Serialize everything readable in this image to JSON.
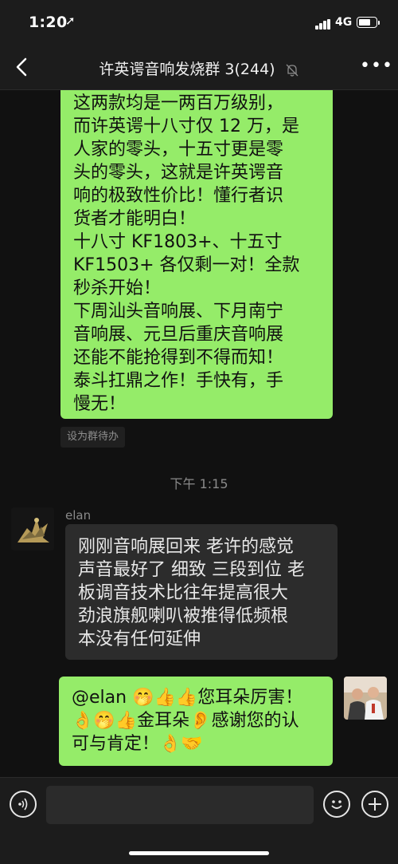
{
  "status": {
    "time": "1:20",
    "network": "4G"
  },
  "nav": {
    "title": "许英谔音响发烧群 3(244)",
    "more": "•••"
  },
  "chat": {
    "msg1_lines": [
      "这两款均是一两百万级别，",
      "而许英谔十八寸仅 12 万，是",
      "人家的零头，十五寸更是零",
      "头的零头，这就是许英谔音",
      "响的极致性价比！懂行者识",
      "货者才能明白！",
      "十八寸 KF1803+、十五寸",
      "KF1503+ 各仅剩一对！全款",
      "秒杀开始！",
      "下周汕头音响展、下月南宁",
      "音响展、元旦后重庆音响展",
      "还能不能抢得到不得而知！",
      "泰斗扛鼎之作！手快有，手",
      "慢无！"
    ],
    "tag": "设为群待办",
    "time_divider": "下午 1:15",
    "sender": "elan",
    "msg2_lines": [
      "刚刚音响展回来 老许的感觉",
      "声音最好了 细致 三段到位 老",
      "板调音技术比往年提高很大",
      "劲浪旗舰喇叭被推得低频根",
      "本没有任何延伸"
    ],
    "msg3_lines": [
      "@elan 🤭👍👍您耳朵厉害！",
      "👌🤭👍金耳朵👂感谢您的认",
      "可与肯定！👌🤝"
    ]
  },
  "colors": {
    "bubble_green": "#95ec69",
    "bubble_gray": "#2c2c2c",
    "background": "#111111"
  },
  "icons": [
    "back-arrow-icon",
    "mute-bell-icon",
    "more-icon",
    "voice-icon",
    "emoji-icon",
    "plus-icon"
  ]
}
